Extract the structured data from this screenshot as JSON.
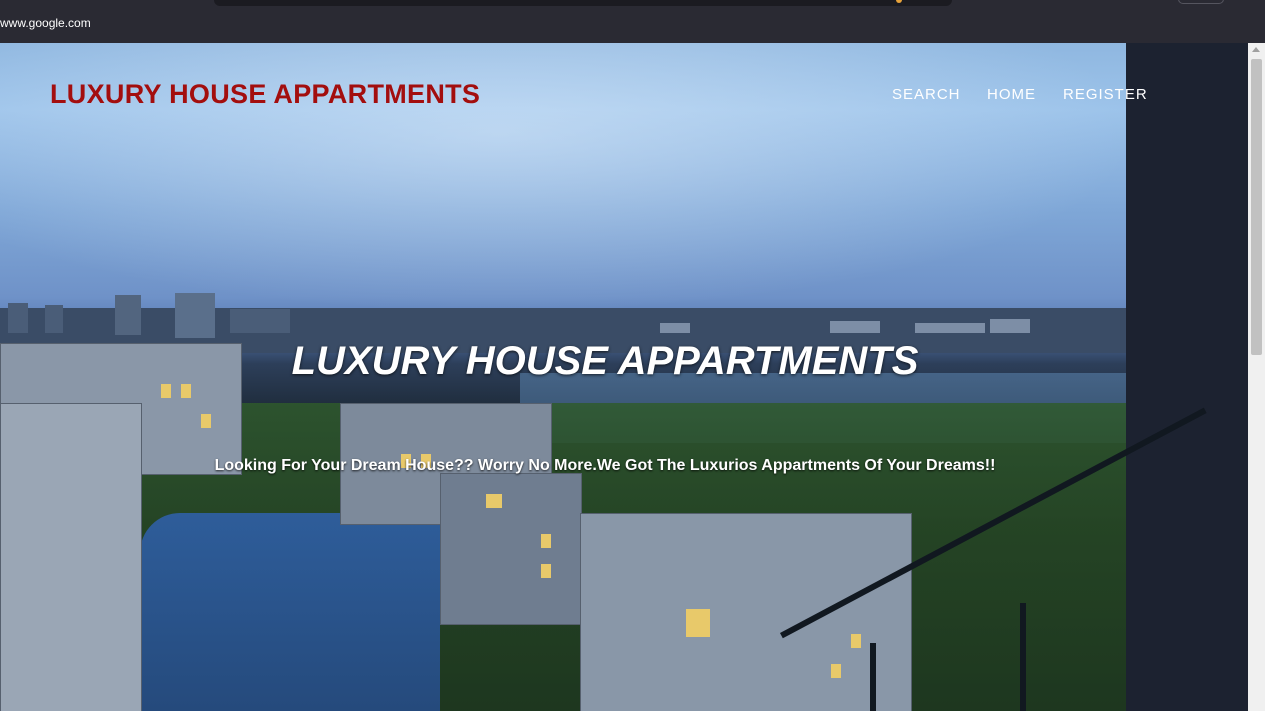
{
  "browser": {
    "status_url": "www.google.com"
  },
  "header": {
    "brand": "LUXURY HOUSE APPARTMENTS",
    "nav": [
      {
        "label": "SEARCH"
      },
      {
        "label": "HOME"
      },
      {
        "label": "REGISTER"
      }
    ]
  },
  "hero": {
    "title": "LUXURY HOUSE APPARTMENTS",
    "subtitle": "Looking For Your Dream House?? Worry No More.We Got The Luxurios Appartments Of Your Dreams!!"
  },
  "colors": {
    "brand": "#a30e0e",
    "nav_text": "#ffffff",
    "chrome": "#2a2a33"
  }
}
